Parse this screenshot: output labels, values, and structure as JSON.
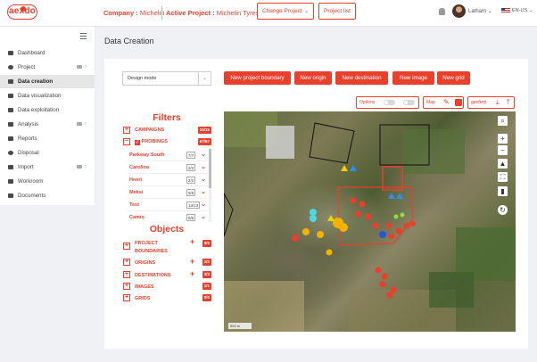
{
  "header": {
    "logo": "aexdo",
    "company_label": "Company :",
    "company_value": "Michelin",
    "project_label": "Active Project :",
    "project_value": "Michelin Tyres",
    "change_project": "Change Project ⌄",
    "project_list": "Project list",
    "user": "Latham ⌄",
    "language": "EN-US ⌄"
  },
  "sidebar": {
    "items": [
      {
        "label": "Dashboard"
      },
      {
        "label": "Project"
      },
      {
        "label": "Data creation"
      },
      {
        "label": "Data visualization"
      },
      {
        "label": "Data exploitation"
      },
      {
        "label": "Analysis"
      },
      {
        "label": "Reports"
      },
      {
        "label": "Disposal"
      },
      {
        "label": "Import"
      },
      {
        "label": "Workroom"
      },
      {
        "label": "Documents"
      }
    ]
  },
  "page": {
    "title": "Data Creation",
    "mode_select": "Design mode"
  },
  "actions": {
    "new_boundary": "New project boundary",
    "new_origin": "New origin",
    "new_destination": "New destination",
    "new_image": "New image",
    "new_grid": "New grid"
  },
  "controls": {
    "options": "Options",
    "map": "Map",
    "gpx": "gpx/kml"
  },
  "filters": {
    "title": "Filters",
    "campaigns_label": "CAMPAIGNS",
    "campaigns_count": "15/15",
    "probings_label": "PROBINGS",
    "probings_count": "67/67",
    "probings": [
      {
        "label": "Parkway South",
        "count": "7/7"
      },
      {
        "label": "Carolina",
        "count": "2/2"
      },
      {
        "label": "Henri",
        "count": "2/2"
      },
      {
        "label": "Meksi",
        "count": "5/5"
      },
      {
        "label": "Test",
        "count": "13/13"
      },
      {
        "label": "Camio",
        "count": "6/6"
      }
    ]
  },
  "objects": {
    "title": "Objects",
    "rows": [
      {
        "label": "PROJECT BOUNDARIES",
        "count": "6/6"
      },
      {
        "label": "ORIGINS",
        "count": "2/2"
      },
      {
        "label": "DESTINATIONS",
        "count": "3/3"
      },
      {
        "label": "IMAGES",
        "count": "1/1"
      },
      {
        "label": "GRIDS",
        "count": "0/0"
      }
    ]
  },
  "map": {
    "scale": "500 m",
    "zoom_in": "+",
    "zoom_out": "−"
  }
}
